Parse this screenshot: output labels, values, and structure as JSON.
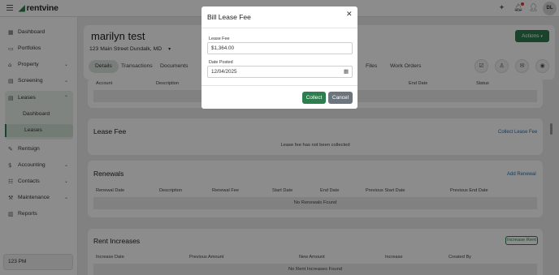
{
  "app": {
    "logo_text": "rentvine",
    "user_initials": "DL"
  },
  "sidebar": {
    "items": [
      {
        "label": "Dashboard"
      },
      {
        "label": "Portfolios"
      },
      {
        "label": "Property"
      },
      {
        "label": "Screening"
      },
      {
        "label": "Leases"
      },
      {
        "label": "Rentsign"
      },
      {
        "label": "Accounting"
      },
      {
        "label": "Contacts"
      },
      {
        "label": "Maintenance"
      },
      {
        "label": "Reports"
      }
    ],
    "lease_sub": [
      {
        "label": "Dashboard"
      },
      {
        "label": "Leases"
      }
    ],
    "time": "123 PM"
  },
  "header": {
    "tenant_name": "marilyn test",
    "address": "123 Main Street Dundalk, MD",
    "actions_label": "Actions",
    "tabs": [
      "Details",
      "Transactions",
      "Documents",
      "Files",
      "Work Orders"
    ]
  },
  "lease_table": {
    "columns": [
      "Account",
      "Description",
      "End Date",
      "Status"
    ]
  },
  "lease_fee": {
    "title": "Lease Fee",
    "link": "Collect Lease Fee",
    "empty": "Lease fee has not been collected"
  },
  "renewals": {
    "title": "Renewals",
    "link": "Add Renewal",
    "columns": [
      "Renewal Date",
      "Description",
      "Renewal Fee",
      "Start Date",
      "End Date",
      "Previous Start Date",
      "Previous End Date"
    ],
    "empty": "No Renewals Found"
  },
  "rent_increases": {
    "title": "Rent Increases",
    "button": "Increase Rent",
    "columns": [
      "Increase Date",
      "Previous Amount",
      "New Amount",
      "Increase",
      "Created By"
    ],
    "empty": "No Rent Increases Found"
  },
  "modal": {
    "title": "Bill Lease Fee",
    "lease_fee_label": "Lease Fee",
    "lease_fee_value": "$1,364.00",
    "date_label": "Date Posted",
    "date_value": "12/04/2025",
    "collect_label": "Collect",
    "cancel_label": "Cancel"
  },
  "colors": {
    "brand_green": "#2e7d4f",
    "link_blue": "#1f6fb2",
    "cancel_gray": "#6c757d"
  }
}
